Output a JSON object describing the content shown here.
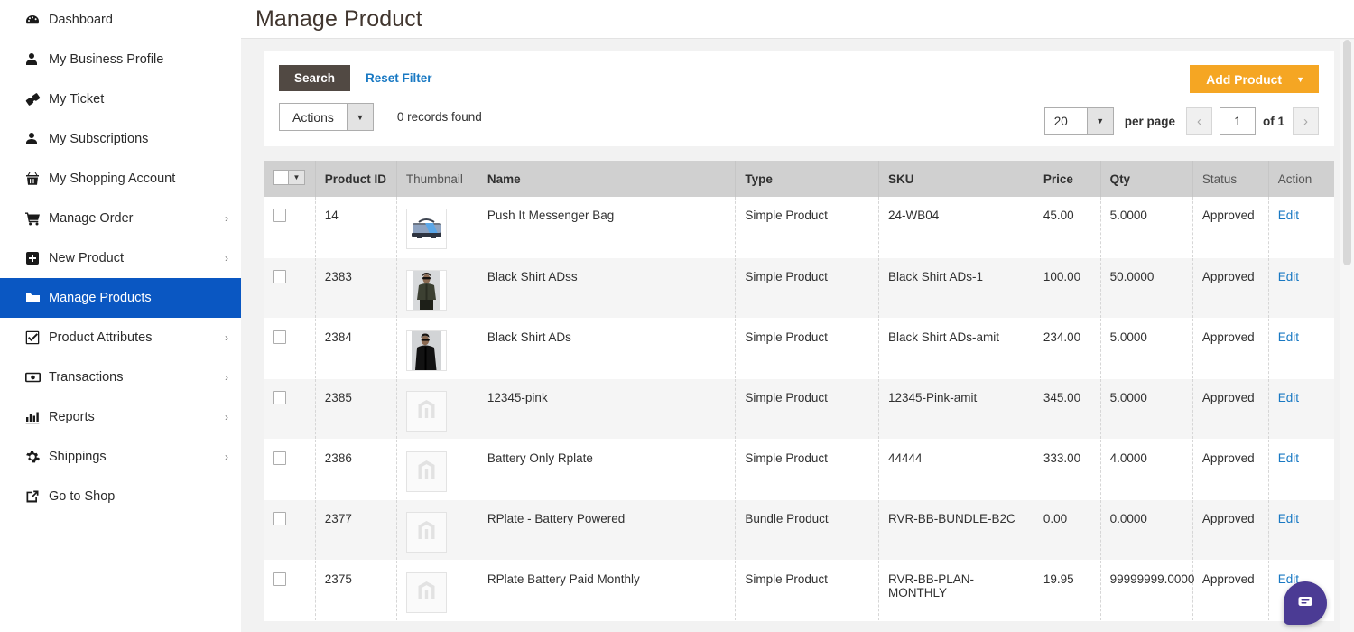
{
  "sidebar": {
    "items": [
      {
        "label": "Dashboard",
        "icon": "dashboard-icon",
        "chevron": "",
        "active": false
      },
      {
        "label": "My Business Profile",
        "icon": "user-icon",
        "chevron": "",
        "active": false
      },
      {
        "label": "My Ticket",
        "icon": "ticket-icon",
        "chevron": "",
        "active": false
      },
      {
        "label": "My Subscriptions",
        "icon": "user-icon",
        "chevron": "",
        "active": false
      },
      {
        "label": "My Shopping Account",
        "icon": "basket-icon",
        "chevron": "",
        "active": false
      },
      {
        "label": "Manage Order",
        "icon": "cart-icon",
        "chevron": "›",
        "active": false
      },
      {
        "label": "New Product",
        "icon": "plus-square-icon",
        "chevron": "›",
        "active": false
      },
      {
        "label": "Manage Products",
        "icon": "folder-icon",
        "chevron": "",
        "active": true
      },
      {
        "label": "Product Attributes",
        "icon": "check-square-icon",
        "chevron": "›",
        "active": false
      },
      {
        "label": "Transactions",
        "icon": "money-icon",
        "chevron": "›",
        "active": false
      },
      {
        "label": "Reports",
        "icon": "bar-chart-icon",
        "chevron": "›",
        "active": false
      },
      {
        "label": "Shippings",
        "icon": "gear-icon",
        "chevron": "›",
        "active": false
      },
      {
        "label": "Go to Shop",
        "icon": "external-link-icon",
        "chevron": "",
        "active": false
      }
    ]
  },
  "header": {
    "title": "Manage Product"
  },
  "toolbar": {
    "search_label": "Search",
    "reset_label": "Reset Filter",
    "actions_label": "Actions",
    "actions_caret": "▼",
    "records_found": "0 records found",
    "add_product_label": "Add Product",
    "add_product_caret": "▼"
  },
  "pagination": {
    "limit_value": "20",
    "limit_caret": "▼",
    "per_page_label": "per page",
    "prev_icon": "‹",
    "next_icon": "›",
    "current_page": "1",
    "of_label": "of 1"
  },
  "grid": {
    "select_all_caret": "▼",
    "columns": [
      {
        "key": "select",
        "label": "",
        "dim": false
      },
      {
        "key": "id",
        "label": "Product ID",
        "dim": false
      },
      {
        "key": "thumbnail",
        "label": "Thumbnail",
        "dim": true
      },
      {
        "key": "name",
        "label": "Name",
        "dim": false
      },
      {
        "key": "type",
        "label": "Type",
        "dim": false
      },
      {
        "key": "sku",
        "label": "SKU",
        "dim": false
      },
      {
        "key": "price",
        "label": "Price",
        "dim": false
      },
      {
        "key": "qty",
        "label": "Qty",
        "dim": false
      },
      {
        "key": "status",
        "label": "Status",
        "dim": true
      },
      {
        "key": "action",
        "label": "Action",
        "dim": true
      }
    ],
    "rows": [
      {
        "id": "14",
        "thumbnail": "messenger-bag-photo",
        "name": "Push It Messenger Bag",
        "type": "Simple Product",
        "sku": "24-WB04",
        "price": "45.00",
        "qty": "5.0000",
        "status": "Approved",
        "action": "Edit"
      },
      {
        "id": "2383",
        "thumbnail": "model-olive-shirt-photo",
        "name": "Black Shirt ADss",
        "type": "Simple Product",
        "sku": "Black Shirt ADs-1",
        "price": "100.00",
        "qty": "50.0000",
        "status": "Approved",
        "action": "Edit"
      },
      {
        "id": "2384",
        "thumbnail": "model-black-shirt-photo",
        "name": "Black Shirt ADs",
        "type": "Simple Product",
        "sku": "Black Shirt ADs-amit",
        "price": "234.00",
        "qty": "5.0000",
        "status": "Approved",
        "action": "Edit"
      },
      {
        "id": "2385",
        "thumbnail": "placeholder-image",
        "name": "12345-pink",
        "type": "Simple Product",
        "sku": "12345-Pink-amit",
        "price": "345.00",
        "qty": "5.0000",
        "status": "Approved",
        "action": "Edit"
      },
      {
        "id": "2386",
        "thumbnail": "placeholder-image",
        "name": "Battery Only Rplate",
        "type": "Simple Product",
        "sku": "44444",
        "price": "333.00",
        "qty": "4.0000",
        "status": "Approved",
        "action": "Edit"
      },
      {
        "id": "2377",
        "thumbnail": "placeholder-image",
        "name": "RPlate - Battery Powered",
        "type": "Bundle Product",
        "sku": "RVR-BB-BUNDLE-B2C",
        "price": "0.00",
        "qty": "0.0000",
        "status": "Approved",
        "action": "Edit"
      },
      {
        "id": "2375",
        "thumbnail": "placeholder-image",
        "name": "RPlate Battery Paid Monthly",
        "type": "Simple Product",
        "sku": "RVR-BB-PLAN-MONTHLY",
        "price": "19.95",
        "qty": "99999999.0000",
        "status": "Approved",
        "action": "Edit"
      }
    ]
  },
  "chat": {
    "icon": "chat-bubble-icon"
  },
  "colors": {
    "sidebar_active": "#0a57c2",
    "search_button": "#514943",
    "link": "#1979c3",
    "add_product": "#f5a623",
    "chat_bubble": "#4b3b94",
    "grid_header": "#d0d0d0"
  }
}
